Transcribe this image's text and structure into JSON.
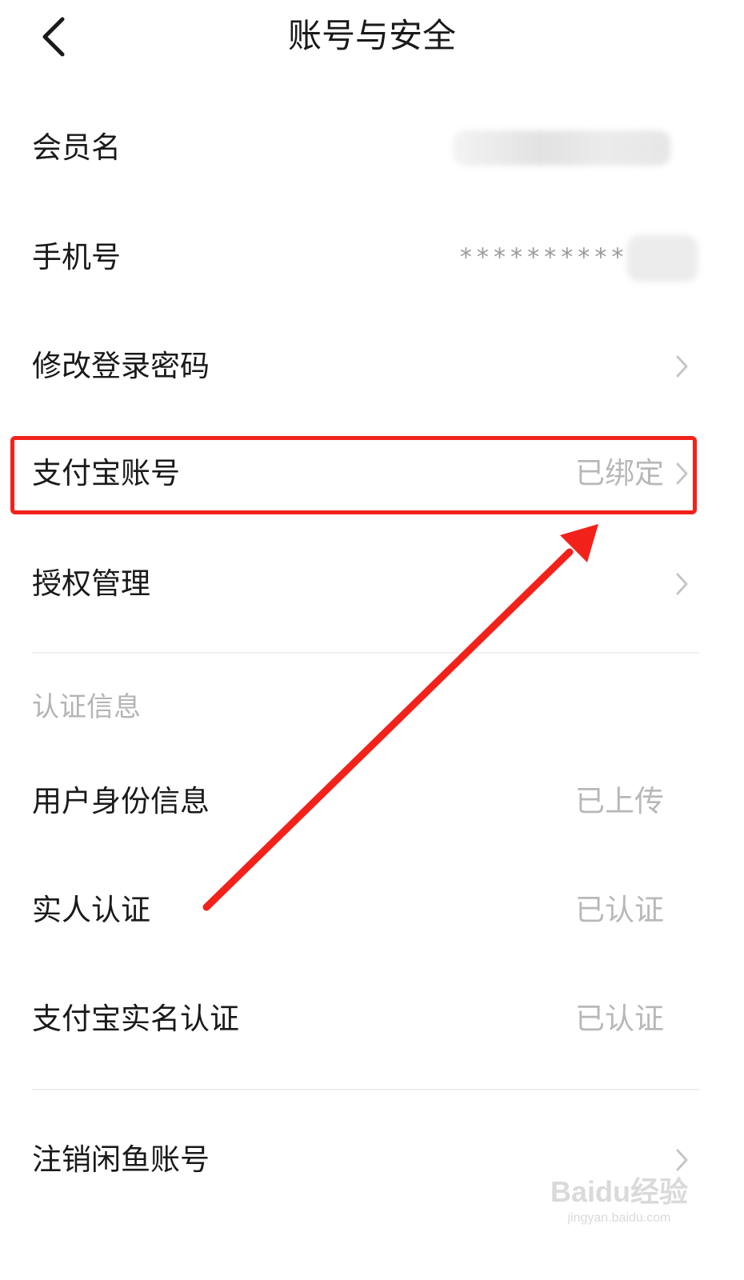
{
  "header": {
    "title": "账号与安全",
    "back_icon": "chevron-left-icon"
  },
  "rows": {
    "member_name": {
      "label": "会员名",
      "value": ""
    },
    "phone": {
      "label": "手机号",
      "value": "**********"
    },
    "change_password": {
      "label": "修改登录密码",
      "icon": "chevron-right-icon"
    },
    "alipay_account": {
      "label": "支付宝账号",
      "value": "已绑定",
      "icon": "chevron-right-icon"
    },
    "authorization": {
      "label": "授权管理",
      "icon": "chevron-right-icon"
    }
  },
  "verification": {
    "section_title": "认证信息",
    "identity": {
      "label": "用户身份信息",
      "value": "已上传"
    },
    "real_person": {
      "label": "实人认证",
      "value": "已认证"
    },
    "alipay_realname": {
      "label": "支付宝实名认证",
      "value": "已认证"
    }
  },
  "cancel_account": {
    "label": "注销闲鱼账号",
    "icon": "chevron-right-icon"
  },
  "annotation": {
    "color": "#f2221b"
  },
  "watermark": {
    "main": "Baidu经验",
    "sub": "jingyan.baidu.com"
  }
}
